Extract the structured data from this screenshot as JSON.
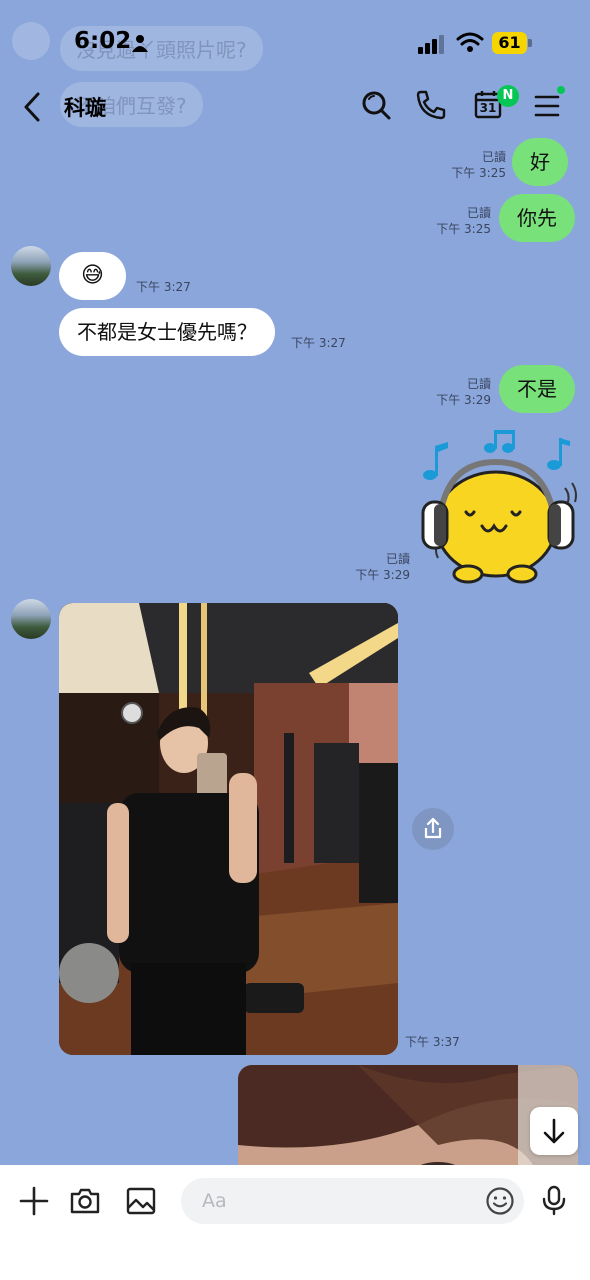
{
  "status_bar": {
    "time": "6:02",
    "battery": "61"
  },
  "ghost_messages": [
    "沒見過丫頭照片呢?",
    "不咱們互發?"
  ],
  "header": {
    "contact_name": "科璇",
    "calendar_day": "31",
    "calendar_badge": "N"
  },
  "messages": [
    {
      "direction": "out",
      "text": "好",
      "read": "已讀",
      "time": "下午 3:25"
    },
    {
      "direction": "out",
      "text": "你先",
      "read": "已讀",
      "time": "下午 3:25"
    },
    {
      "direction": "in",
      "text": "😅",
      "time": "下午 3:27"
    },
    {
      "direction": "in",
      "text": "不都是女士優先嗎？",
      "time": "下午 3:27"
    },
    {
      "direction": "out",
      "text": "不是",
      "read": "已讀",
      "time": "下午 3:29"
    },
    {
      "direction": "out",
      "type": "sticker",
      "read": "已讀",
      "time": "下午 3:29"
    },
    {
      "direction": "in",
      "type": "photo",
      "time": "下午 3:37"
    },
    {
      "direction": "out",
      "type": "photo"
    }
  ],
  "composer": {
    "placeholder": "Aa"
  },
  "colors": {
    "background": "#8aa6da",
    "outgoing_bubble": "#79e17a",
    "incoming_bubble": "#ffffff",
    "accent": "#06c755"
  }
}
